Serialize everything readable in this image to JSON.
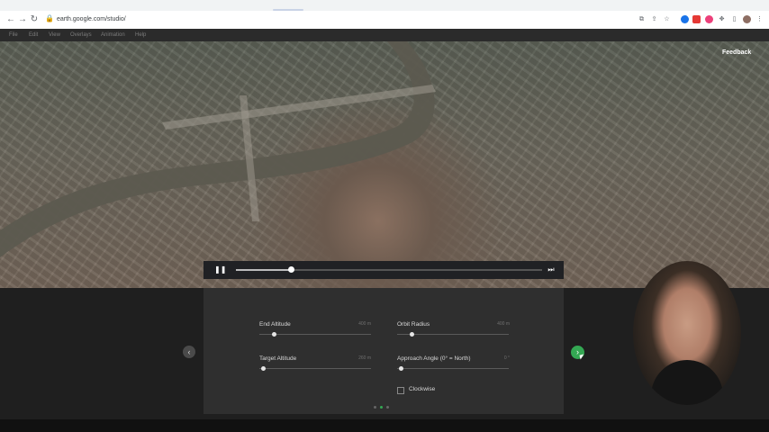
{
  "browser": {
    "url": "earth.google.com/studio/",
    "nav": {
      "back": "←",
      "forward": "→",
      "reload": "↻"
    },
    "lock_icon": "lock-icon",
    "extensions": [
      "screenshot-icon",
      "share-icon",
      "bookmark-star-icon",
      "extension-icon-red",
      "extension-icon-pink",
      "puzzle-icon",
      "sidepanel-icon",
      "avatar",
      "menu-kebab-icon"
    ]
  },
  "menubar": {
    "items": [
      "File",
      "Edit",
      "View",
      "Overlays",
      "Animation",
      "Help"
    ]
  },
  "map": {
    "feedback_label": "Feedback",
    "player": {
      "pause_glyph": "❚❚",
      "end_glyph": "⏭",
      "progress": 0.18
    }
  },
  "panel": {
    "fields": [
      {
        "label": "End Altitude",
        "value": "400 m",
        "level": 0.13
      },
      {
        "label": "Orbit Radius",
        "value": "400 m",
        "level": 0.13
      },
      {
        "label": "Target Altitude",
        "value": "260 m",
        "level": 0.03
      },
      {
        "label": "Approach Angle (0° = North)",
        "value": "0 °",
        "level": 0.03
      }
    ],
    "checkbox_label": "Clockwise",
    "checkbox_checked": false,
    "page_dots": 3,
    "active_dot": 1
  },
  "nav_buttons": {
    "prev": "‹",
    "next": "›"
  },
  "colors": {
    "accent": "#34a853",
    "panel": "#2f2f2f",
    "menubar": "#2b2b2b"
  }
}
